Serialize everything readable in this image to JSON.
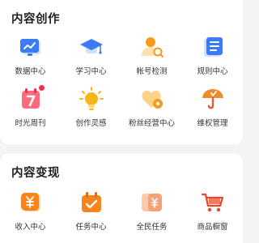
{
  "colors": {
    "blue_light": "#cfe0ff",
    "blue": "#3b7cf6",
    "orange_light": "#ffe0b0",
    "orange": "#f79a1c",
    "red": "#e8334a"
  },
  "creation": {
    "title": "内容创作",
    "items": [
      {
        "label": "数据中心",
        "icon": "chart-board-icon"
      },
      {
        "label": "学习中心",
        "icon": "graduation-cap-icon"
      },
      {
        "label": "帐号检测",
        "icon": "user-search-icon"
      },
      {
        "label": "规则中心",
        "icon": "rule-book-icon"
      },
      {
        "label": "时光周刊",
        "icon": "calendar-7-icon",
        "badge_dot": true
      },
      {
        "label": "创作灵感",
        "icon": "lightbulb-icon"
      },
      {
        "label": "粉丝经营中心",
        "icon": "heart-settings-icon"
      },
      {
        "label": "维权管理",
        "icon": "umbrella-icon"
      }
    ]
  },
  "monetization": {
    "title": "内容变现",
    "items": [
      {
        "label": "收入中心",
        "icon": "yuan-wallet-icon"
      },
      {
        "label": "任务中心",
        "icon": "task-calendar-icon"
      },
      {
        "label": "全民任务",
        "icon": "yuan-cards-icon"
      },
      {
        "label": "商品橱窗",
        "icon": "shopping-cart-icon"
      }
    ]
  }
}
